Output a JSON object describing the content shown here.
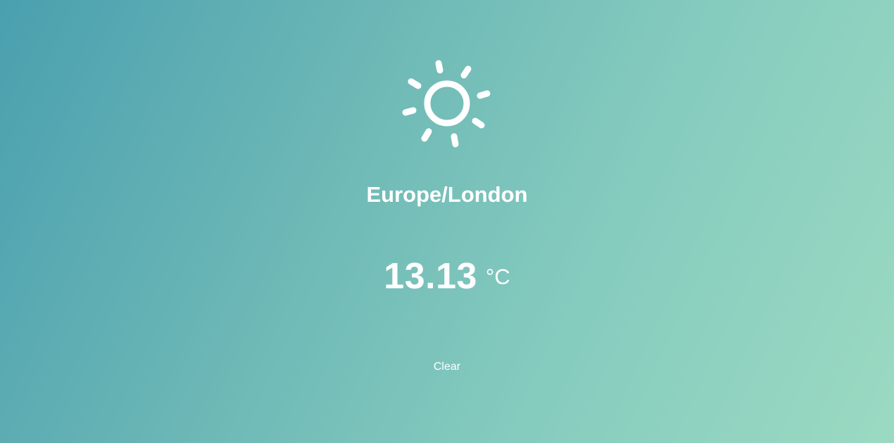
{
  "weather": {
    "icon": "sun-icon",
    "location": "Europe/London",
    "temperature": "13.13",
    "unit": "°C",
    "description": "Clear"
  },
  "colors": {
    "gradient_start": "#4aa0af",
    "gradient_end": "#9bdac2",
    "text": "#ffffff"
  }
}
